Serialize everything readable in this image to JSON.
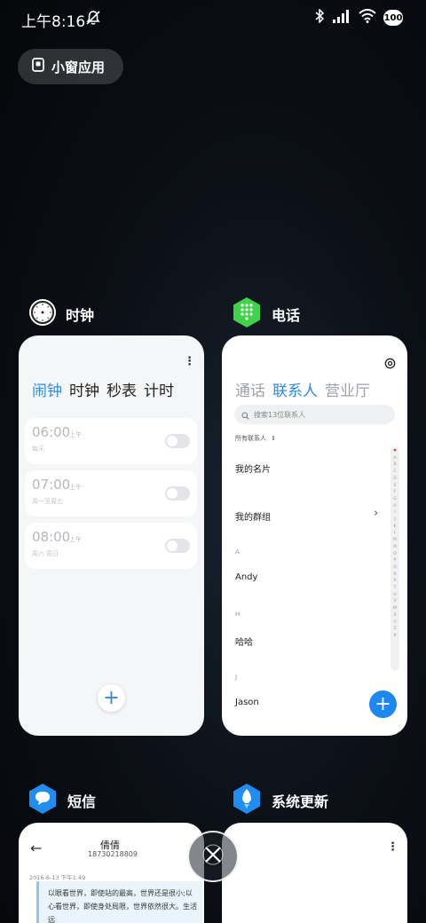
{
  "status_bar": {
    "time": "上午8:16",
    "battery": "100"
  },
  "float_apps": {
    "label": "小窗应用"
  },
  "apps": {
    "clock": {
      "name": "时钟",
      "tabs": [
        "闹钟",
        "时钟",
        "秒表",
        "计时"
      ],
      "alarms": [
        {
          "time": "06:00",
          "ampm": "上午",
          "repeat": "每天"
        },
        {
          "time": "07:00",
          "ampm": "上午",
          "repeat": "周一至周五"
        },
        {
          "time": "08:00",
          "ampm": "上午",
          "repeat": "周六 周日"
        }
      ]
    },
    "phone": {
      "name": "电话",
      "tabs": [
        "通话",
        "联系人",
        "营业厅"
      ],
      "search_placeholder": "搜索13位联系人",
      "filter": "所有联系人",
      "my_card": "我的名片",
      "my_groups": "我的群组",
      "sections": [
        {
          "letter": "A",
          "contact": "Andy"
        },
        {
          "letter": "H",
          "contact": "哈哈"
        },
        {
          "letter": "J",
          "contact": "Jason"
        }
      ],
      "alphabet": [
        "♥",
        "A",
        "B",
        "C",
        "D",
        "E",
        "F",
        "G",
        "H",
        "I",
        "J",
        "K",
        "L",
        "M",
        "N",
        "O",
        "P",
        "Q",
        "R",
        "S",
        "T",
        "U",
        "V",
        "W",
        "X",
        "Y",
        "Z",
        "#"
      ]
    },
    "sms": {
      "name": "短信",
      "contact_name": "倩倩",
      "contact_number": "18730218809",
      "timestamp": "2016-6-13 下午1:49",
      "message": "以眼看世界，即使站的最高，世界还是很小;以心看世界，即使身处局限，世界依然很大。生活远"
    },
    "updater": {
      "name": "系统更新"
    }
  },
  "colors": {
    "accent": "#2e8be6",
    "fab_blue": "#1e88f0"
  }
}
